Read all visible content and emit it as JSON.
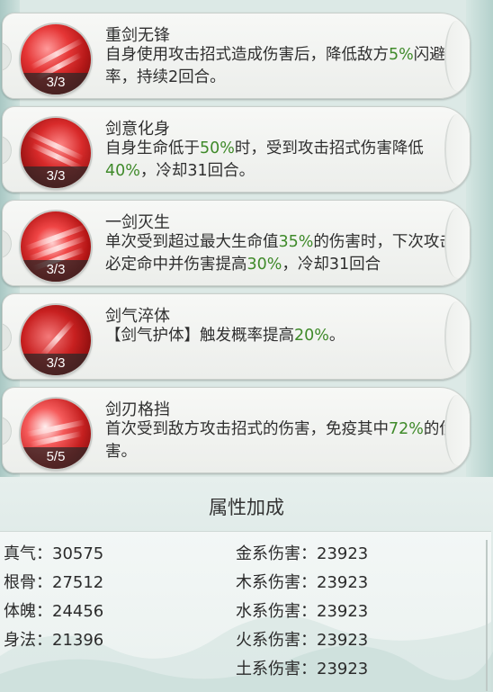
{
  "skills": [
    {
      "name": "重剑无锋",
      "rank": "3/3",
      "desc": [
        {
          "t": "自身使用攻击招式造成伤害后，降低敌方"
        },
        {
          "t": "5%",
          "g": true
        },
        {
          "t": "闪避概率，持续2回合。"
        }
      ]
    },
    {
      "name": "剑意化身",
      "rank": "3/3",
      "desc": [
        {
          "t": "自身生命低于"
        },
        {
          "t": "50%",
          "g": true
        },
        {
          "t": "时，受到攻击招式伤害降低"
        },
        {
          "t": "40%",
          "g": true
        },
        {
          "t": "，冷却31回合。"
        }
      ]
    },
    {
      "name": "一剑灭生",
      "rank": "3/3",
      "desc": [
        {
          "t": "单次受到超过最大生命值"
        },
        {
          "t": "35%",
          "g": true
        },
        {
          "t": "的伤害时，下次攻击必定命中并伤害提高"
        },
        {
          "t": "30%",
          "g": true
        },
        {
          "t": "，冷却31回合"
        }
      ]
    },
    {
      "name": "剑气淬体",
      "rank": "3/3",
      "desc": [
        {
          "t": "【剑气护体】触发概率提高"
        },
        {
          "t": "20%",
          "g": true
        },
        {
          "t": "。"
        }
      ]
    },
    {
      "name": "剑刃格挡",
      "rank": "5/5",
      "desc": [
        {
          "t": "首次受到敌方攻击招式的伤害，免疫其中"
        },
        {
          "t": "72%",
          "g": true
        },
        {
          "t": "的伤害。"
        }
      ]
    }
  ],
  "attributes": {
    "title": "属性加成",
    "left": [
      {
        "label": "真气：",
        "value": "30575"
      },
      {
        "label": "根骨：",
        "value": "27512"
      },
      {
        "label": "体魄：",
        "value": "24456"
      },
      {
        "label": "身法：",
        "value": "21396"
      }
    ],
    "right": [
      {
        "label": "金系伤害：",
        "value": "23923"
      },
      {
        "label": "木系伤害：",
        "value": "23923"
      },
      {
        "label": "水系伤害：",
        "value": "23923"
      },
      {
        "label": "火系伤害：",
        "value": "23923"
      },
      {
        "label": "土系伤害：",
        "value": "23923"
      }
    ]
  },
  "colors": {
    "highlight_green": "#3f8a2a",
    "icon_red": "#d82a2a"
  }
}
